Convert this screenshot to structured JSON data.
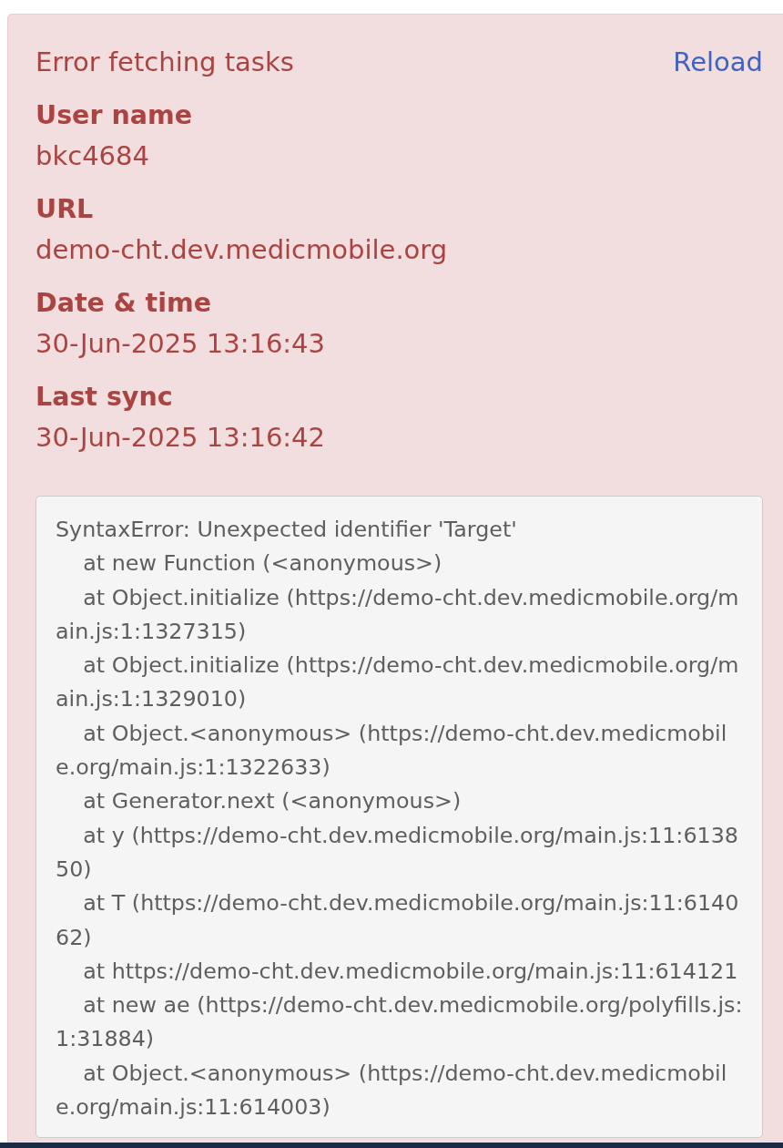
{
  "alert": {
    "title": "Error fetching tasks",
    "action": "Reload",
    "fields": [
      {
        "label": "User name",
        "value": "bkc4684"
      },
      {
        "label": "URL",
        "value": "demo-cht.dev.medicmobile.org"
      },
      {
        "label": "Date & time",
        "value": "30-Jun-2025 13:16:43"
      },
      {
        "label": "Last sync",
        "value": "30-Jun-2025 13:16:42"
      }
    ],
    "stack_trace": "SyntaxError: Unexpected identifier 'Target'\n    at new Function (<anonymous>)\n    at Object.initialize (https://demo-cht.dev.medicmobile.org/main.js:1:1327315)\n    at Object.initialize (https://demo-cht.dev.medicmobile.org/main.js:1:1329010)\n    at Object.<anonymous> (https://demo-cht.dev.medicmobile.org/main.js:1:1322633)\n    at Generator.next (<anonymous>)\n    at y (https://demo-cht.dev.medicmobile.org/main.js:11:613850)\n    at T (https://demo-cht.dev.medicmobile.org/main.js:11:614062)\n    at https://demo-cht.dev.medicmobile.org/main.js:11:614121\n    at new ae (https://demo-cht.dev.medicmobile.org/polyfills.js:1:31884)\n    at Object.<anonymous> (https://demo-cht.dev.medicmobile.org/main.js:11:614003)"
  }
}
